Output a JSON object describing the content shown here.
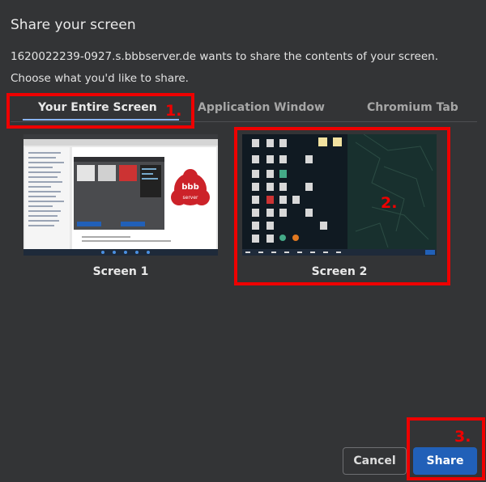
{
  "dialog": {
    "title": "Share your screen",
    "description": "1620022239-0927.s.bbbserver.de wants to share the contents of your screen.",
    "prompt": "Choose what you'd like to share."
  },
  "tabs": [
    {
      "label": "Your Entire Screen",
      "selected": true
    },
    {
      "label": "Application Window",
      "selected": false
    },
    {
      "label": "Chromium Tab",
      "selected": false
    }
  ],
  "screens": [
    {
      "label": "Screen 1",
      "selected": false
    },
    {
      "label": "Screen 2",
      "selected": true
    }
  ],
  "annotations": [
    "1.",
    "2.",
    "3."
  ],
  "thumb1": {
    "logo_text": "bbb",
    "logo_sub": "server"
  },
  "buttons": {
    "cancel": "Cancel",
    "share": "Share"
  },
  "colors": {
    "accent": "#8ab4f8",
    "annotation": "#ee0000",
    "share_button": "#2160b8",
    "background": "#333436"
  }
}
